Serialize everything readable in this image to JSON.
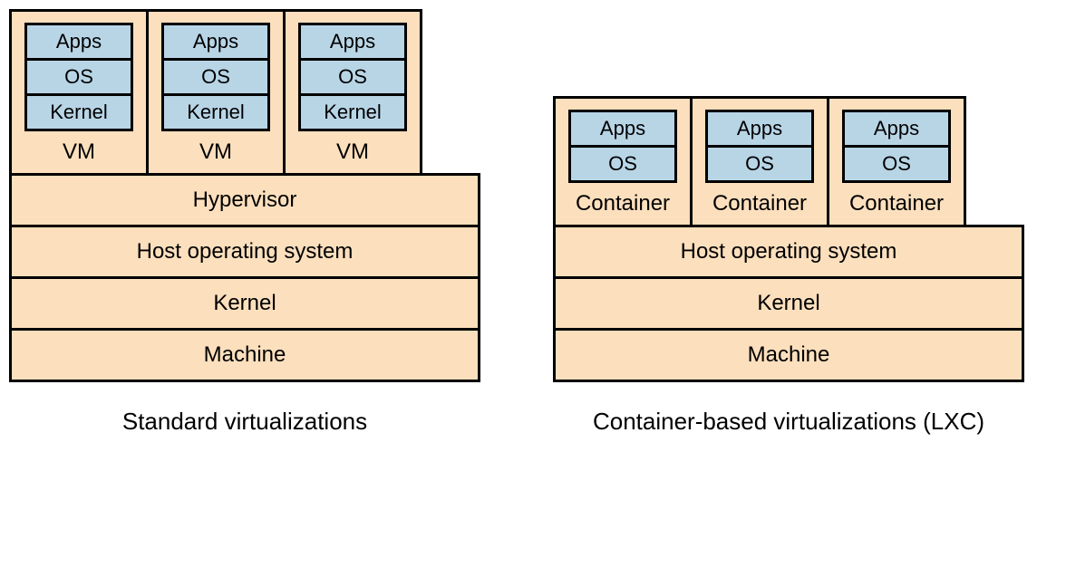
{
  "left": {
    "units": [
      {
        "apps": "Apps",
        "os": "OS",
        "kernel": "Kernel",
        "label": "VM"
      },
      {
        "apps": "Apps",
        "os": "OS",
        "kernel": "Kernel",
        "label": "VM"
      },
      {
        "apps": "Apps",
        "os": "OS",
        "kernel": "Kernel",
        "label": "VM"
      }
    ],
    "hypervisor": "Hypervisor",
    "host_os": "Host operating system",
    "kernel": "Kernel",
    "machine": "Machine",
    "caption": "Standard virtualizations"
  },
  "right": {
    "units": [
      {
        "apps": "Apps",
        "os": "OS",
        "label": "Container"
      },
      {
        "apps": "Apps",
        "os": "OS",
        "label": "Container"
      },
      {
        "apps": "Apps",
        "os": "OS",
        "label": "Container"
      }
    ],
    "host_os": "Host operating system",
    "kernel": "Kernel",
    "machine": "Machine",
    "caption": "Container-based virtualizations (LXC)"
  }
}
